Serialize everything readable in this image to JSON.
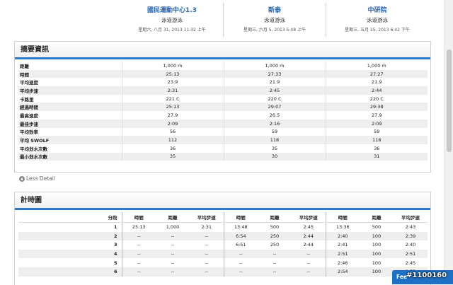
{
  "activities": [
    {
      "title": "國民運動中心1.3",
      "type": "泳道游泳",
      "date": "星期六, 八月 31, 2013 11:32 上午"
    },
    {
      "title": "新泰",
      "type": "泳道游泳",
      "date": "星期三, 六月 5, 2013 5:48 上午"
    },
    {
      "title": "中研院",
      "type": "泳道游泳",
      "date": "星期三, 五月 15, 2013 6:42 下午"
    }
  ],
  "summary": {
    "title": "摘要資訊",
    "rows": [
      {
        "label": "距離",
        "values": [
          "1,000 m",
          "1,000 m",
          "1,000 m"
        ]
      },
      {
        "label": "時間",
        "values": [
          "25:13",
          "27:33",
          "27:27"
        ]
      },
      {
        "label": "平均速度",
        "values": [
          "23.9",
          "21.9",
          "21.9"
        ]
      },
      {
        "label": "平均步速",
        "values": [
          "2:31",
          "2:45",
          "2:44"
        ]
      },
      {
        "label": "卡路里",
        "values": [
          "221 C",
          "220 C",
          "220 C"
        ]
      },
      {
        "label": "經過時間",
        "values": [
          "25:13",
          "29:07",
          "29:38"
        ]
      },
      {
        "label": "最高速度",
        "values": [
          "27.9",
          "26.5",
          "27.9"
        ]
      },
      {
        "label": "最佳步速",
        "values": [
          "2:09",
          "2:16",
          "2:09"
        ]
      },
      {
        "label": "平均效率",
        "values": [
          "56",
          "59",
          "59"
        ]
      },
      {
        "label": "平均 SWOLF",
        "values": [
          "112",
          "118",
          "118"
        ]
      },
      {
        "label": "平均划水次數",
        "values": [
          "36",
          "35",
          "36"
        ]
      },
      {
        "label": "最小划水次數",
        "values": [
          "35",
          "30",
          "31"
        ]
      }
    ],
    "less_detail": "Less Detail"
  },
  "splits": {
    "title": "計時圖",
    "lap_header": "分段",
    "col_headers": [
      "時間",
      "距離",
      "平均步速"
    ],
    "rows": [
      {
        "lap": "1",
        "cells": [
          "25:13",
          "1,000",
          "2:31",
          "13:48",
          "500",
          "2:45",
          "13:36",
          "500",
          "2:43"
        ]
      },
      {
        "lap": "2",
        "cells": [
          "--",
          "--",
          "--",
          "6:54",
          "250",
          "2:44",
          "2:40",
          "100",
          "2:39"
        ]
      },
      {
        "lap": "3",
        "cells": [
          "--",
          "--",
          "--",
          "6:51",
          "250",
          "2:44",
          "2:41",
          "100",
          "2:40"
        ]
      },
      {
        "lap": "4",
        "cells": [
          "--",
          "--",
          "--",
          "--",
          "--",
          "--",
          "2:51",
          "100",
          "2:51"
        ]
      },
      {
        "lap": "5",
        "cells": [
          "--",
          "--",
          "--",
          "--",
          "--",
          "--",
          "2:46",
          "100",
          "2:45"
        ]
      },
      {
        "lap": "6",
        "cells": [
          "--",
          "--",
          "--",
          "--",
          "--",
          "--",
          "2:54",
          "100",
          "2:53"
        ]
      }
    ]
  },
  "feedback": "Fee",
  "watermark": "#1100160"
}
